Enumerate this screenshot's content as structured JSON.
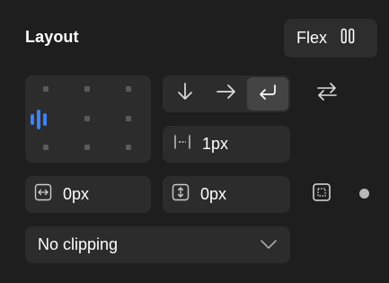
{
  "header": {
    "title": "Layout",
    "mode_label": "Flex",
    "mode_icon": "columns-icon"
  },
  "alignment": {
    "selected": "left-center",
    "accent_color": "#3b82f6"
  },
  "direction": {
    "options": [
      {
        "icon": "arrow-down-icon",
        "value": "vertical"
      },
      {
        "icon": "arrow-right-icon",
        "value": "horizontal"
      },
      {
        "icon": "wrap-icon",
        "value": "wrap"
      }
    ],
    "selected": "wrap"
  },
  "gap": {
    "value": "1px",
    "icon": "gap-icon"
  },
  "padding": {
    "horizontal": {
      "value": "0px",
      "icon": "horizontal-padding-icon"
    },
    "vertical": {
      "value": "0px",
      "icon": "vertical-padding-icon"
    }
  },
  "clipping": {
    "value": "No clipping",
    "icon": "chevron-down-icon"
  },
  "colors": {
    "background": "#1e1e1e",
    "panel": "#2c2c2c",
    "active": "#444444",
    "accent": "#3b82f6"
  }
}
